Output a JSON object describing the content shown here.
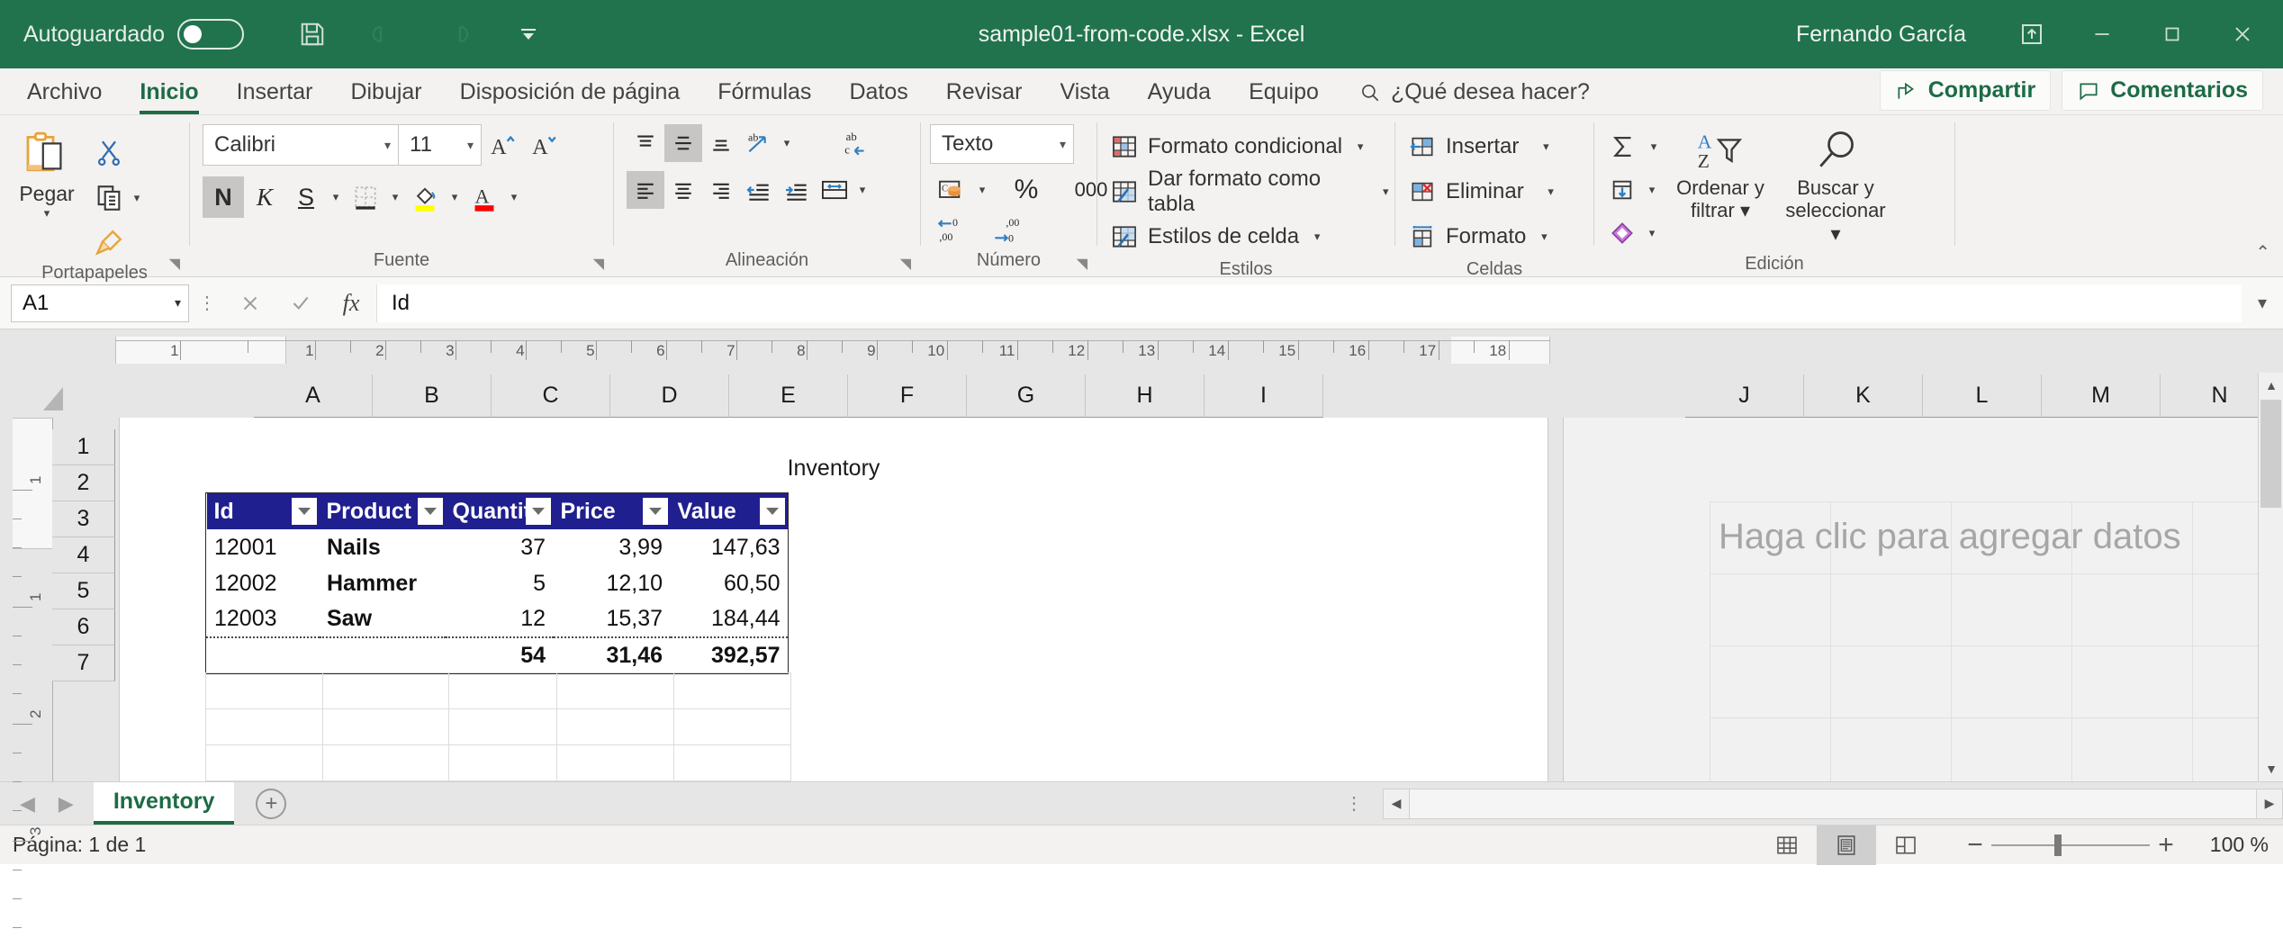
{
  "titlebar": {
    "autosave_label": "Autoguardado",
    "autosave_state": "off",
    "document_title": "sample01-from-code.xlsx  -  Excel",
    "username": "Fernando García",
    "quick_access": [
      "save-icon",
      "undo-icon",
      "redo-icon",
      "customize-qat-icon"
    ],
    "window_buttons": [
      "ribbon-display-options-icon",
      "minimize-icon",
      "maximize-icon",
      "close-icon"
    ],
    "brand_color": "#21734d"
  },
  "ribbon_tabs": {
    "items": [
      {
        "label": "Archivo",
        "active": false
      },
      {
        "label": "Inicio",
        "active": true
      },
      {
        "label": "Insertar",
        "active": false
      },
      {
        "label": "Dibujar",
        "active": false
      },
      {
        "label": "Disposición de página",
        "active": false
      },
      {
        "label": "Fórmulas",
        "active": false
      },
      {
        "label": "Datos",
        "active": false
      },
      {
        "label": "Revisar",
        "active": false
      },
      {
        "label": "Vista",
        "active": false
      },
      {
        "label": "Ayuda",
        "active": false
      },
      {
        "label": "Equipo",
        "active": false
      }
    ],
    "tell_me": "¿Qué desea hacer?",
    "share_label": "Compartir",
    "comments_label": "Comentarios"
  },
  "ribbon": {
    "clipboard": {
      "group_name": "Portapapeles",
      "paste_label": "Pegar",
      "cut_name": "cut-icon",
      "copy_name": "copy-icon",
      "format_painter_name": "format-painter-icon"
    },
    "font": {
      "group_name": "Fuente",
      "font_family": "Calibri",
      "font_size": "11",
      "grow_label": "A",
      "shrink_label": "A",
      "bold_label": "N",
      "italic_label": "K",
      "underline_label": "S",
      "bold_active": true,
      "highlight_color": "#ffff00",
      "font_color": "#ff0000"
    },
    "alignment": {
      "group_name": "Alineación",
      "align_top": "align-top-icon",
      "align_middle": "align-middle-icon",
      "align_bottom": "align-bottom-icon",
      "orientation": "text-orientation-icon",
      "wrap_text": "wrap-text-icon",
      "align_left": "align-left-icon",
      "align_center": "align-center-icon",
      "align_right": "align-right-icon",
      "decrease_indent": "decrease-indent-icon",
      "increase_indent": "increase-indent-icon",
      "merge_cells": "merge-and-center-icon",
      "vertical_active": "middle",
      "horizontal_active": "left"
    },
    "number": {
      "group_name": "Número",
      "format_value": "Texto",
      "accounting": "accounting-format-icon",
      "percent": "%",
      "comma": "000",
      "increase_decimal": "increase-decimal-icon",
      "decrease_decimal": "decrease-decimal-icon"
    },
    "styles": {
      "group_name": "Estilos",
      "items": [
        {
          "label": "Formato condicional",
          "icon": "conditional-formatting-icon"
        },
        {
          "label": "Dar formato como tabla",
          "icon": "format-as-table-icon"
        },
        {
          "label": "Estilos de celda",
          "icon": "cell-styles-icon"
        }
      ]
    },
    "cells": {
      "group_name": "Celdas",
      "items": [
        {
          "label": "Insertar",
          "icon": "insert-cells-icon"
        },
        {
          "label": "Eliminar",
          "icon": "delete-cells-icon"
        },
        {
          "label": "Formato",
          "icon": "format-cells-icon"
        }
      ]
    },
    "editing": {
      "group_name": "Edición",
      "autosum": "autosum-icon",
      "fill": "fill-icon",
      "clear": "clear-icon",
      "sort_filter_label": "Ordenar y\nfiltrar",
      "sort_filter_line1": "Ordenar y",
      "sort_filter_line2": "filtrar",
      "find_select_line1": "Buscar y",
      "find_select_line2": "seleccionar"
    }
  },
  "formula_bar": {
    "name_box": "A1",
    "cancel_icon": "cancel-icon",
    "accept_icon": "accept-icon",
    "function_icon": "insert-function-icon",
    "formula_value": "Id",
    "expand_icon": "expand-formula-bar-icon"
  },
  "worksheet": {
    "column_headers": [
      "A",
      "B",
      "C",
      "D",
      "E",
      "F",
      "G",
      "H",
      "I",
      "J",
      "K",
      "L",
      "M",
      "N"
    ],
    "row_headers": [
      "1",
      "2",
      "3",
      "4",
      "5",
      "6",
      "7"
    ],
    "ruler_numbers_h": [
      "1",
      "1",
      "2",
      "3",
      "4",
      "5",
      "6",
      "7",
      "8",
      "9",
      "10",
      "11",
      "12",
      "13",
      "14",
      "15",
      "16",
      "17",
      "18"
    ],
    "ruler_numbers_v": [
      "1",
      "1",
      "2",
      "3"
    ],
    "document_title": "Inventory",
    "placeholder_text": "Haga clic para agregar datos",
    "table": {
      "header_bg": "#1f1f8f",
      "header_fg": "#ffffff",
      "columns": [
        "Id",
        "Product",
        "Quantit",
        "Price",
        "Value"
      ],
      "rows": [
        {
          "id": "12001",
          "product": "Nails",
          "quantity": "37",
          "price": "3,99",
          "value": "147,63"
        },
        {
          "id": "12002",
          "product": "Hammer",
          "quantity": "5",
          "price": "12,10",
          "value": "60,50"
        },
        {
          "id": "12003",
          "product": "Saw",
          "quantity": "12",
          "price": "15,37",
          "value": "184,44"
        }
      ],
      "total_row": {
        "id": "",
        "product": "",
        "quantity": "54",
        "price": "31,46",
        "value": "392,57"
      }
    }
  },
  "sheet_tabs": {
    "prev_icon": "previous-sheet-icon",
    "next_icon": "next-sheet-icon",
    "tabs": [
      {
        "label": "Inventory",
        "active": true
      }
    ],
    "add_sheet_icon": "add-sheet-icon"
  },
  "status_bar": {
    "page_status": "Página: 1 de 1",
    "view_normal": "normal-view-icon",
    "view_page_layout": "page-layout-view-icon",
    "view_page_break": "page-break-preview-icon",
    "active_view": "page-layout",
    "zoom_out": "−",
    "zoom_in": "+",
    "zoom_level": "100 %"
  }
}
